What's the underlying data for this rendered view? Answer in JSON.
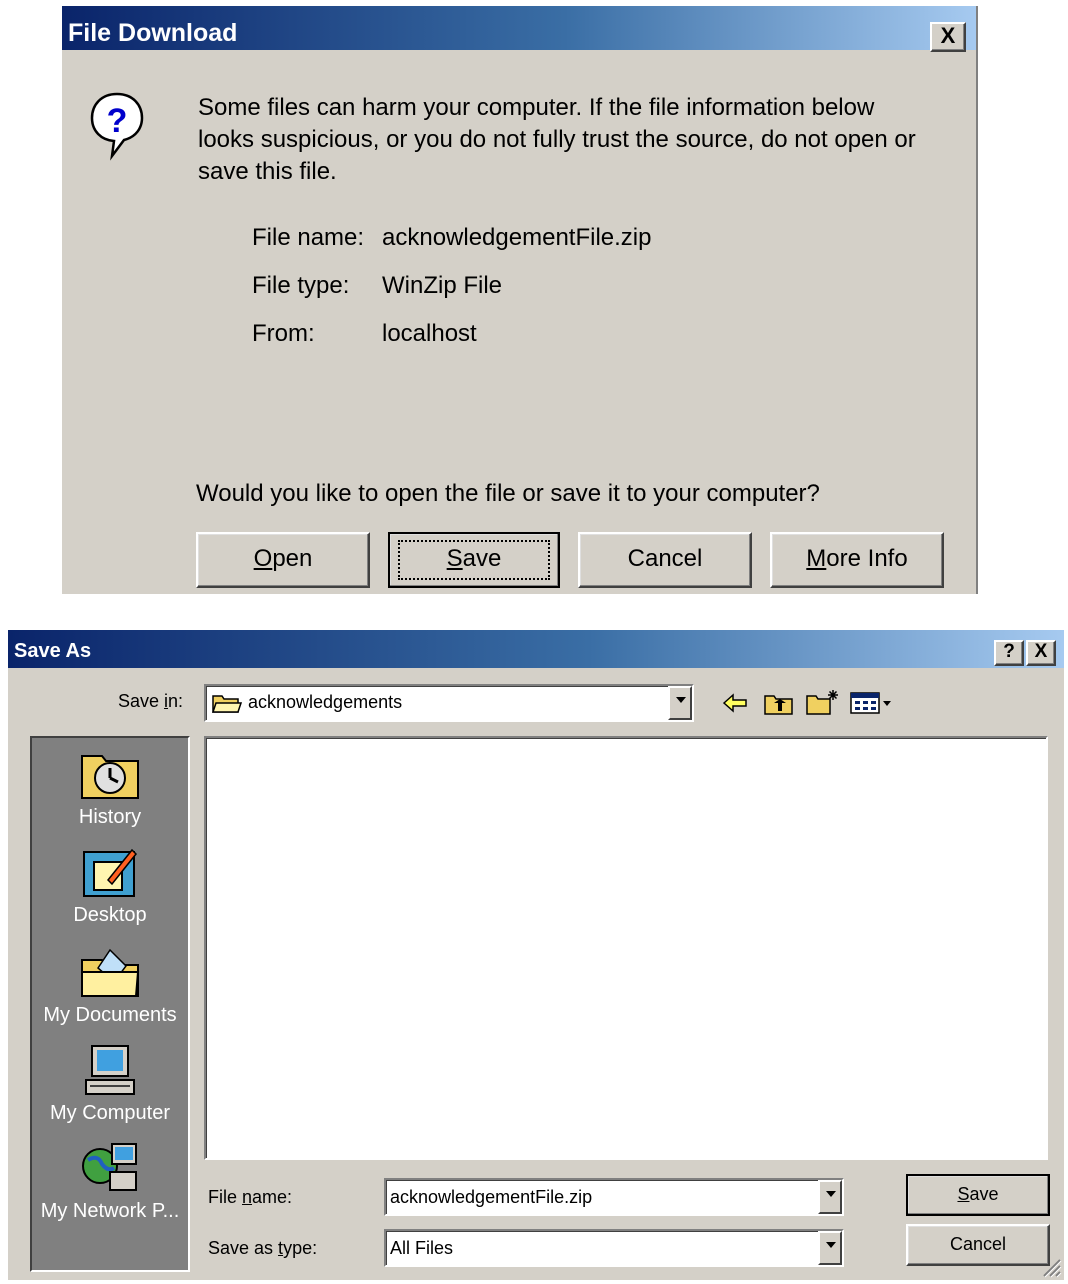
{
  "file_download": {
    "title": "File Download",
    "close_label": "X",
    "warning": [
      "Some files can harm your computer. If the file information below",
      "looks suspicious, or you do not fully trust the source, do not open or",
      "save this file."
    ],
    "fields": [
      {
        "label": "File name:",
        "value": "acknowledgementFile.zip"
      },
      {
        "label": "File type:",
        "value": "WinZip File"
      },
      {
        "label": "From:",
        "value": "localhost"
      }
    ],
    "question": "Would you like to open the file or save it to your computer?",
    "buttons": {
      "open_u": "O",
      "open_rest": "pen",
      "save_u": "S",
      "save_rest": "ave",
      "cancel": "Cancel",
      "more_u": "M",
      "more_rest": "ore Info"
    }
  },
  "save_as": {
    "title": "Save As",
    "help_label": "?",
    "close_label": "X",
    "save_in_a": "Save ",
    "save_in_u": "i",
    "save_in_b": "n:",
    "current_folder": "acknowledgements",
    "places": [
      "History",
      "Desktop",
      "My Documents",
      "My Computer",
      "My Network P..."
    ],
    "file_name_a": "File ",
    "file_name_u": "n",
    "file_name_b": "ame:",
    "file_name_value": "acknowledgementFile.zip",
    "save_type_a": "Save as ",
    "save_type_u": "t",
    "save_type_b": "ype:",
    "save_type_value": "All Files",
    "save_u": "S",
    "save_rest": "ave",
    "cancel": "Cancel"
  },
  "colors": {
    "title_start": "#0a246a",
    "title_end": "#a6caf0",
    "face": "#d4d0c8",
    "places_bg": "#808080"
  }
}
